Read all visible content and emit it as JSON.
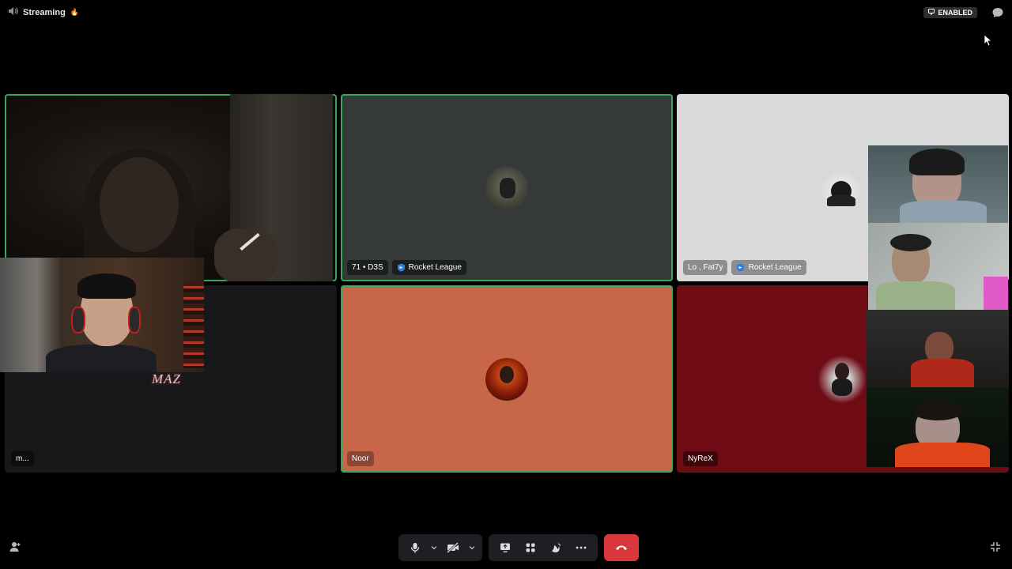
{
  "topbar": {
    "channel_name": "Streaming",
    "channel_emoji": "🔥",
    "status_pill": "ENABLED"
  },
  "tiles": [
    {
      "id": "tile-1",
      "type": "video",
      "speaking": true,
      "name": ""
    },
    {
      "id": "tile-2",
      "type": "avatar",
      "speaking": true,
      "name": "71 • D3S",
      "activity": "Rocket League",
      "bg": "#35393a"
    },
    {
      "id": "tile-3",
      "type": "avatar",
      "speaking": false,
      "name": "Lo , Fat7y",
      "activity": "Rocket League",
      "bg": "#d9d9d9"
    },
    {
      "id": "tile-4",
      "type": "dark",
      "speaking": false,
      "name": "m...",
      "bg": "#18181a"
    },
    {
      "id": "tile-5",
      "type": "avatar",
      "speaking": true,
      "name": "Noor",
      "bg": "#c8664a"
    },
    {
      "id": "tile-6",
      "type": "avatar",
      "speaking": false,
      "name": "NyReX",
      "bg": "#6e0b15"
    }
  ],
  "overlay": {
    "watermark": "MAZ"
  },
  "controls": {
    "mic": "microphone-icon",
    "camera": "camera-off-icon",
    "screenshare": "screen-share-icon",
    "activities": "activities-icon",
    "soundboard": "soundboard-icon",
    "more": "more-icon",
    "disconnect": "hangup-icon"
  },
  "colors": {
    "speaking_ring": "#3ba55d",
    "hangup": "#da373c",
    "control_bg": "#1e1f22"
  }
}
